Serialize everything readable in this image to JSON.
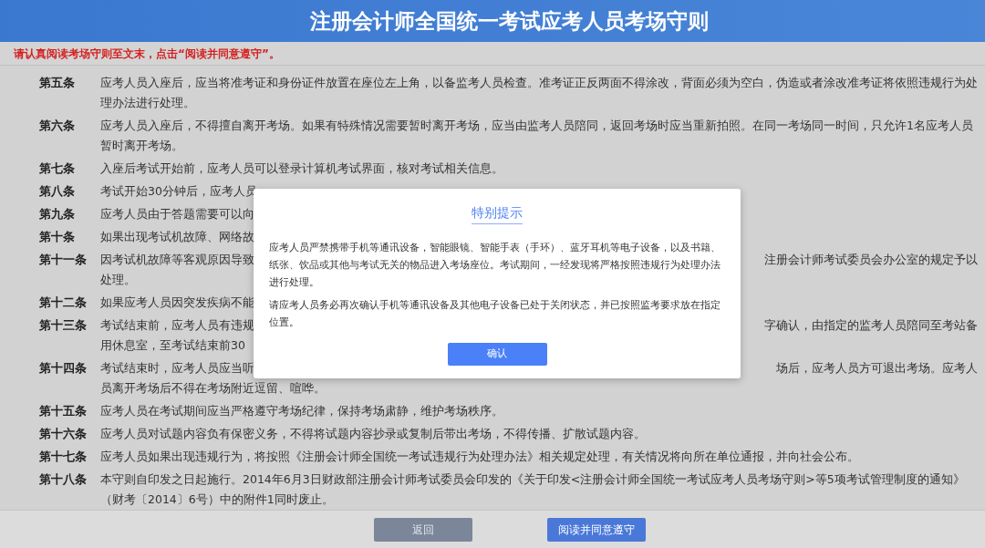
{
  "header": {
    "title": "注册会计师全国统一考试应考人员考场守则"
  },
  "notice": "请认真阅读考场守则至文末，点击“阅读并同意遵守”。",
  "articles": [
    {
      "label": "第五条",
      "lines": [
        {
          "text": "应考人员入座后，应当将准考证和身份证件放置在座位左上角，以备监考人员检查。准考证正反两面不得涂改，背面必须为空白，伪造或者涂改准考证将依照违规行为处"
        },
        {
          "text": "理办法进行处理。"
        }
      ]
    },
    {
      "label": "第六条",
      "lines": [
        {
          "text": "应考人员入座后，不得擅自离开考场。如果有特殊情况需要暂时离开考场，应当由监考人员陪同，返回考场时应当重新拍照。在同一考场同一时间，只允许1名应考人员"
        },
        {
          "text": "暂时离开考场。"
        }
      ]
    },
    {
      "label": "第七条",
      "lines": [
        {
          "text": "入座后考试开始前，应考人员可以登录计算机考试界面，核对考试相关信息。"
        }
      ]
    },
    {
      "label": "第八条",
      "lines": [
        {
          "text": "考试开始30分钟后，应考人员"
        }
      ]
    },
    {
      "label": "第九条",
      "lines": [
        {
          "text": "应考人员由于答题需要可以向"
        }
      ]
    },
    {
      "label": "第十条",
      "lines": [
        {
          "text": "如果出现考试机故障、网络故"
        }
      ]
    },
    {
      "label": "第十一条",
      "lines": [
        {
          "text": "因考试机故障等客观原因导致",
          "right": "注册会计师考试委员会办公室的规定予以"
        },
        {
          "text": "处理。"
        }
      ]
    },
    {
      "label": "第十二条",
      "lines": [
        {
          "text": "如果应考人员因突发疾病不能"
        }
      ]
    },
    {
      "label": "第十三条",
      "lines": [
        {
          "text": "考试结束前，应考人员有违规",
          "right": "字确认，由指定的监考人员陪同至考站备"
        },
        {
          "text": "用休息室，至考试结束前30"
        }
      ]
    },
    {
      "label": "第十四条",
      "lines": [
        {
          "text": "考试结束时，应考人员应当听",
          "right": "场后，应考人员方可退出考场。应考人"
        },
        {
          "text": "员离开考场后不得在考场附近逗留、喧哗。"
        }
      ]
    },
    {
      "label": "第十五条",
      "lines": [
        {
          "text": "应考人员在考试期间应当严格遵守考场纪律，保持考场肃静，维护考场秩序。"
        }
      ]
    },
    {
      "label": "第十六条",
      "lines": [
        {
          "text": "应考人员对试题内容负有保密义务，不得将试题内容抄录或复制后带出考场，不得传播、扩散试题内容。"
        }
      ]
    },
    {
      "label": "第十七条",
      "lines": [
        {
          "text": "应考人员如果出现违规行为，将按照《注册会计师全国统一考试违规行为处理办法》相关规定处理，有关情况将向所在单位通报，并向社会公布。"
        }
      ]
    },
    {
      "label": "第十八条",
      "lines": [
        {
          "text": "本守则自印发之日起施行。2014年6月3日财政部注册会计师考试委员会印发的《关于印发<注册会计师全国统一考试应考人员考场守则>等5项考试管理制度的通知》"
        },
        {
          "text": "（财考〔2014〕6号）中的附件1同时废止。"
        }
      ]
    }
  ],
  "footer_buttons": [
    {
      "label": "返回",
      "kind": "secondary"
    },
    {
      "label": "阅读并同意遵守",
      "kind": "primary"
    }
  ],
  "dialog": {
    "title": "特别提示",
    "paragraphs": [
      "应考人员严禁携带手机等通讯设备，智能眼镜、智能手表（手环）、蓝牙耳机等电子设备，以及书籍、纸张、饮品或其他与考试无关的物品进入考场座位。考试期间，一经发现将严格按照违规行为处理办法进行处理。",
      "请应考人员务必再次确认手机等通讯设备及其他电子设备已处于关闭状态，并已按照监考要求放在指定位置。"
    ],
    "button": "确认"
  }
}
